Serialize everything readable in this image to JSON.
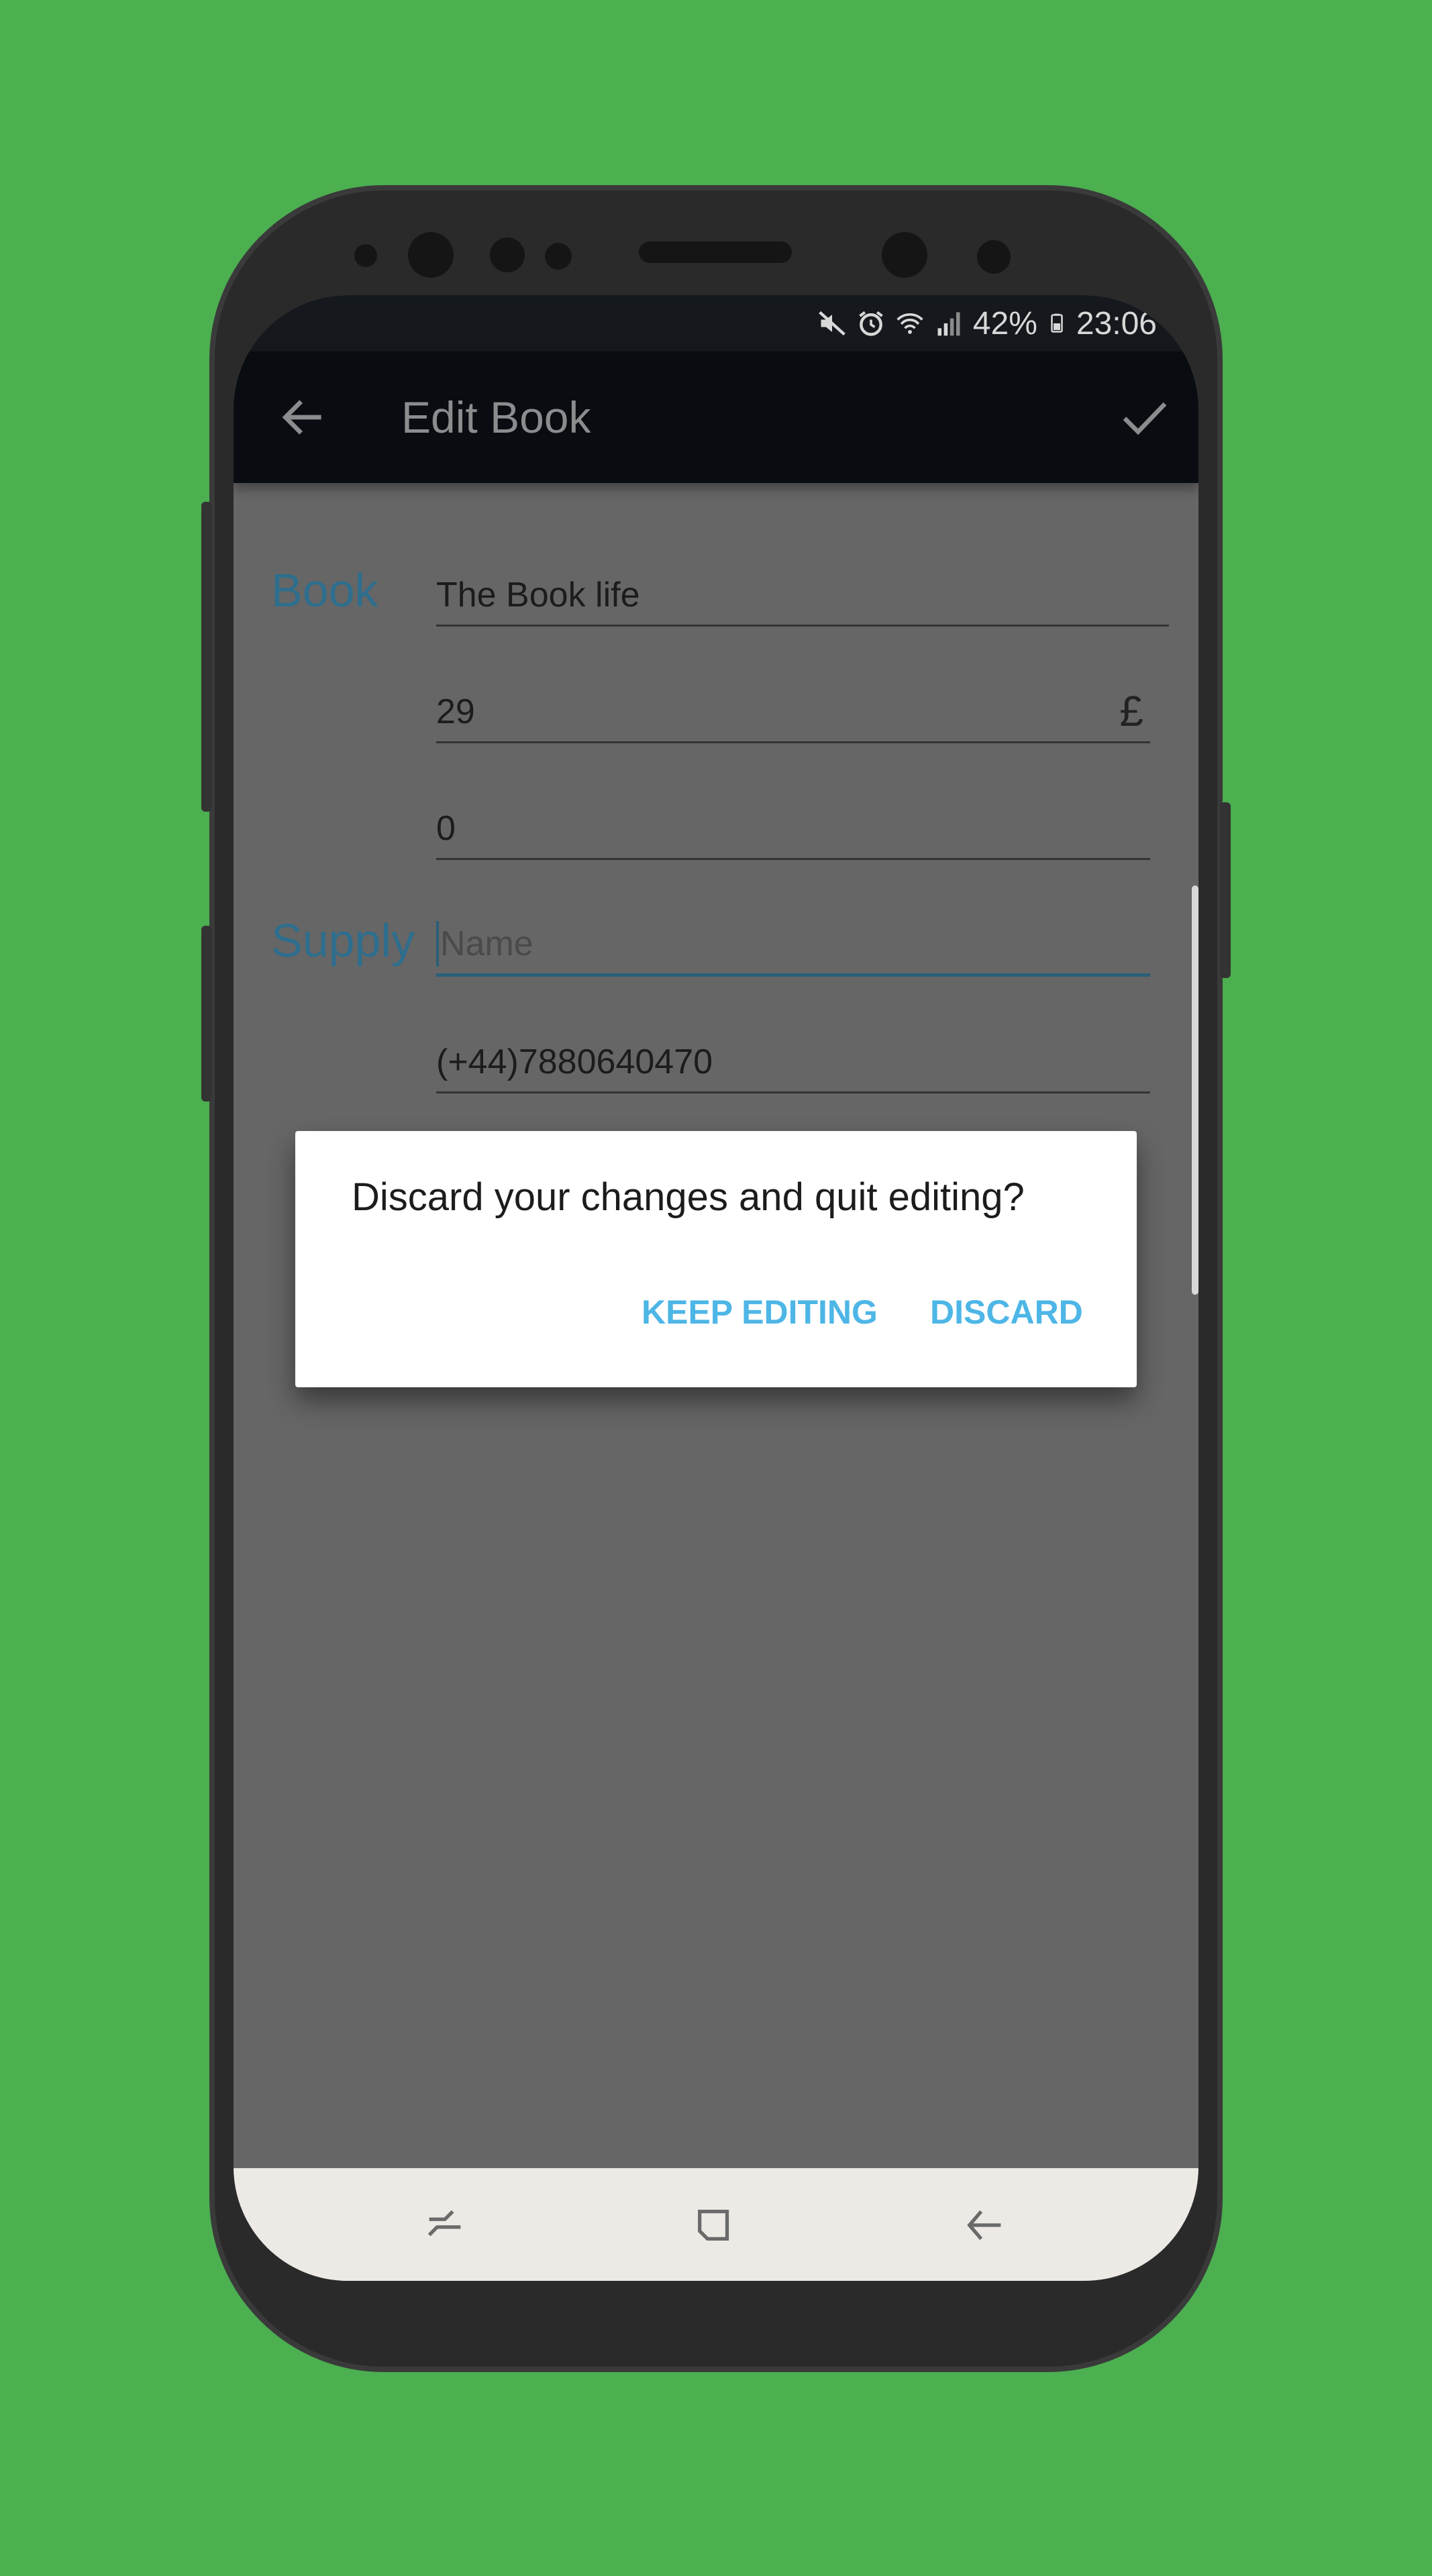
{
  "colors": {
    "background": "#4caf50",
    "accent": "#2e6e8e",
    "dialog_button": "#4db6e6",
    "app_bar": "#090d11"
  },
  "status_bar": {
    "battery": "42%",
    "time": "23:06",
    "icons": [
      "mute-icon",
      "alarm-icon",
      "wifi-icon",
      "signal-icon",
      "battery-icon"
    ]
  },
  "app_bar": {
    "title": "Edit Book",
    "back_icon": "arrow-left-icon",
    "save_icon": "checkmark-icon"
  },
  "form": {
    "book_label": "Book",
    "title_value": "The Book life",
    "price_value": "29",
    "currency_symbol": "£",
    "quantity_value": "0",
    "supply_label": "Supply",
    "supplier_name_placeholder": "Name",
    "supplier_phone_value": "(+44)7880640470"
  },
  "dialog": {
    "message": "Discard your changes and quit editing?",
    "keep_label": "KEEP EDITING",
    "discard_label": "DISCARD"
  },
  "nav_bar": {
    "icons": [
      "recent-apps-icon",
      "home-icon",
      "back-icon"
    ]
  }
}
